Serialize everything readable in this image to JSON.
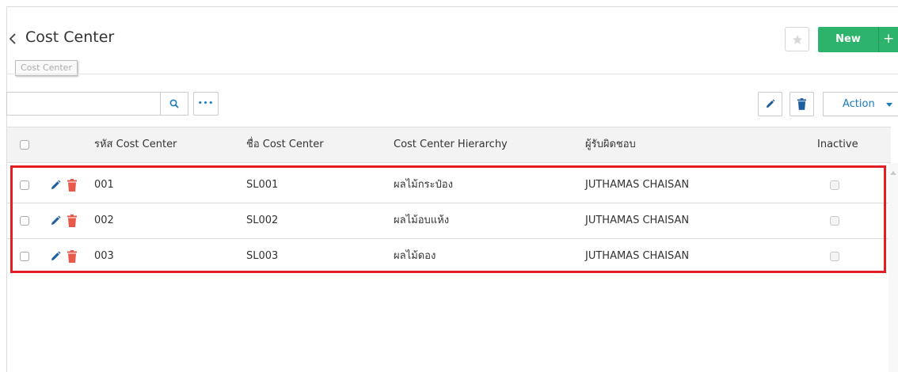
{
  "header": {
    "title": "Cost Center",
    "tooltip": "Cost Center",
    "new_label": "New",
    "plus_label": "+"
  },
  "toolbar": {
    "search_value": "",
    "more_label": "•••",
    "action_label": "Action"
  },
  "table": {
    "columns": [
      "รหัส Cost Center",
      "ชื่อ Cost Center",
      "Cost Center Hierarchy",
      "ผู้รับผิดชอบ",
      "Inactive"
    ],
    "rows": [
      {
        "code": "001",
        "name": "SL001",
        "hierarchy": "ผลไม้กระป๋อง",
        "owner": "JUTHAMAS CHAISAN"
      },
      {
        "code": "002",
        "name": "SL002",
        "hierarchy": "ผลไม้อบแห้ง",
        "owner": "JUTHAMAS CHAISAN"
      },
      {
        "code": "003",
        "name": "SL003",
        "hierarchy": "ผลไม้ดอง",
        "owner": "JUTHAMAS CHAISAN"
      }
    ]
  },
  "colors": {
    "primary_green": "#2db36b",
    "action_blue": "#1a7bc0",
    "edit_blue": "#1f5f9e",
    "delete_red": "#e8594a",
    "highlight_red": "#e31e24"
  },
  "icons": [
    "back-icon",
    "star-icon",
    "search-icon",
    "more-icon",
    "pencil-icon",
    "trash-icon",
    "caret-down-icon"
  ]
}
